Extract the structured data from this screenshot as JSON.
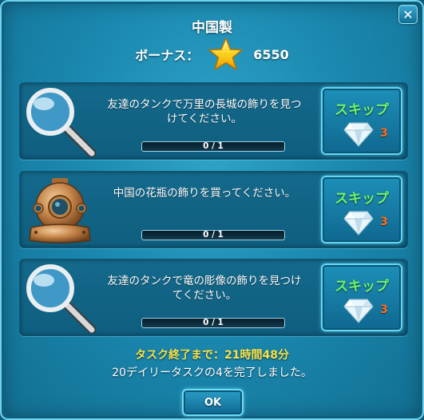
{
  "dialog": {
    "title": "中国製",
    "close_label": "✕",
    "bonus": {
      "label": "ボーナス：",
      "value": "6550",
      "icon": "star-icon"
    }
  },
  "tasks": [
    {
      "icon": "magnifier-icon",
      "description": "友達のタンクで万里の長城の飾りを見つけてください。",
      "progress": {
        "current": 0,
        "total": 1,
        "text": "0 / 1"
      },
      "skip": {
        "label": "スキップ",
        "cost": "3",
        "icon": "diamond-icon"
      }
    },
    {
      "icon": "diving-helmet-icon",
      "description": "中国の花瓶の飾りを買ってください。",
      "progress": {
        "current": 0,
        "total": 1,
        "text": "0 / 1"
      },
      "skip": {
        "label": "スキップ",
        "cost": "3",
        "icon": "diamond-icon"
      }
    },
    {
      "icon": "magnifier-icon",
      "description": "友達のタンクで竜の彫像の飾りを見つけてください。",
      "progress": {
        "current": 0,
        "total": 1,
        "text": "0 / 1"
      },
      "skip": {
        "label": "スキップ",
        "cost": "3",
        "icon": "diamond-icon"
      }
    }
  ],
  "footer": {
    "timer": "タスク終了まで：21時間48分",
    "daily_status": "20デイリータスクの4を完了しました。",
    "ok_label": "OK"
  },
  "colors": {
    "panel": "#1b89b0",
    "skip_text": "#6ff36a",
    "cost_text": "#ff6a1f",
    "timer_text": "#f6e24b"
  }
}
